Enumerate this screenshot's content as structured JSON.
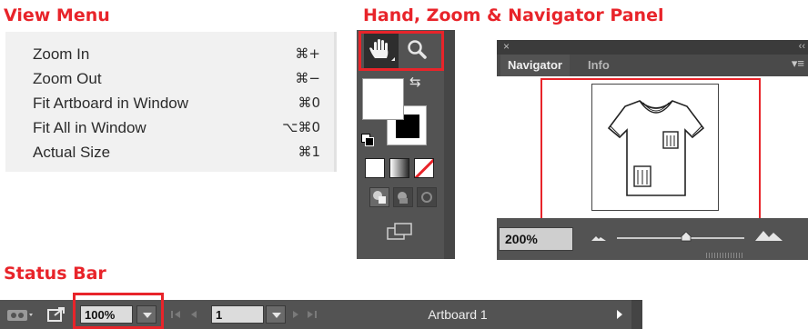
{
  "headings": {
    "view_menu": "View Menu",
    "nav_panel": "Hand, Zoom & Navigator Panel",
    "status_bar": "Status Bar"
  },
  "view_menu": {
    "items": [
      {
        "label": "Zoom In",
        "shortcut": "⌘+"
      },
      {
        "label": "Zoom Out",
        "shortcut": "⌘−"
      },
      {
        "label": "Fit Artboard in Window",
        "shortcut": "⌘0"
      },
      {
        "label": "Fit All in Window",
        "shortcut": "⌥⌘0"
      },
      {
        "label": "Actual Size",
        "shortcut": "⌘1"
      }
    ]
  },
  "tools_panel": {
    "icons": [
      "hand-icon",
      "zoom-icon",
      "swap-fill-stroke-icon",
      "default-colors-icon",
      "screen-mode-icon"
    ]
  },
  "navigator": {
    "tabs": {
      "navigator": "Navigator",
      "info": "Info"
    },
    "close_glyph": "×",
    "collapse_glyph": "‹‹",
    "zoom_value": "200%",
    "zoom_slider_level": 0.54
  },
  "status_bar": {
    "zoom_value": "100%",
    "artboard_number": "1",
    "current_tool": "Artboard 1"
  },
  "colors": {
    "accent_red": "#e8242a",
    "panel_gray": "#535353",
    "menu_bg": "#f1f1f1"
  }
}
